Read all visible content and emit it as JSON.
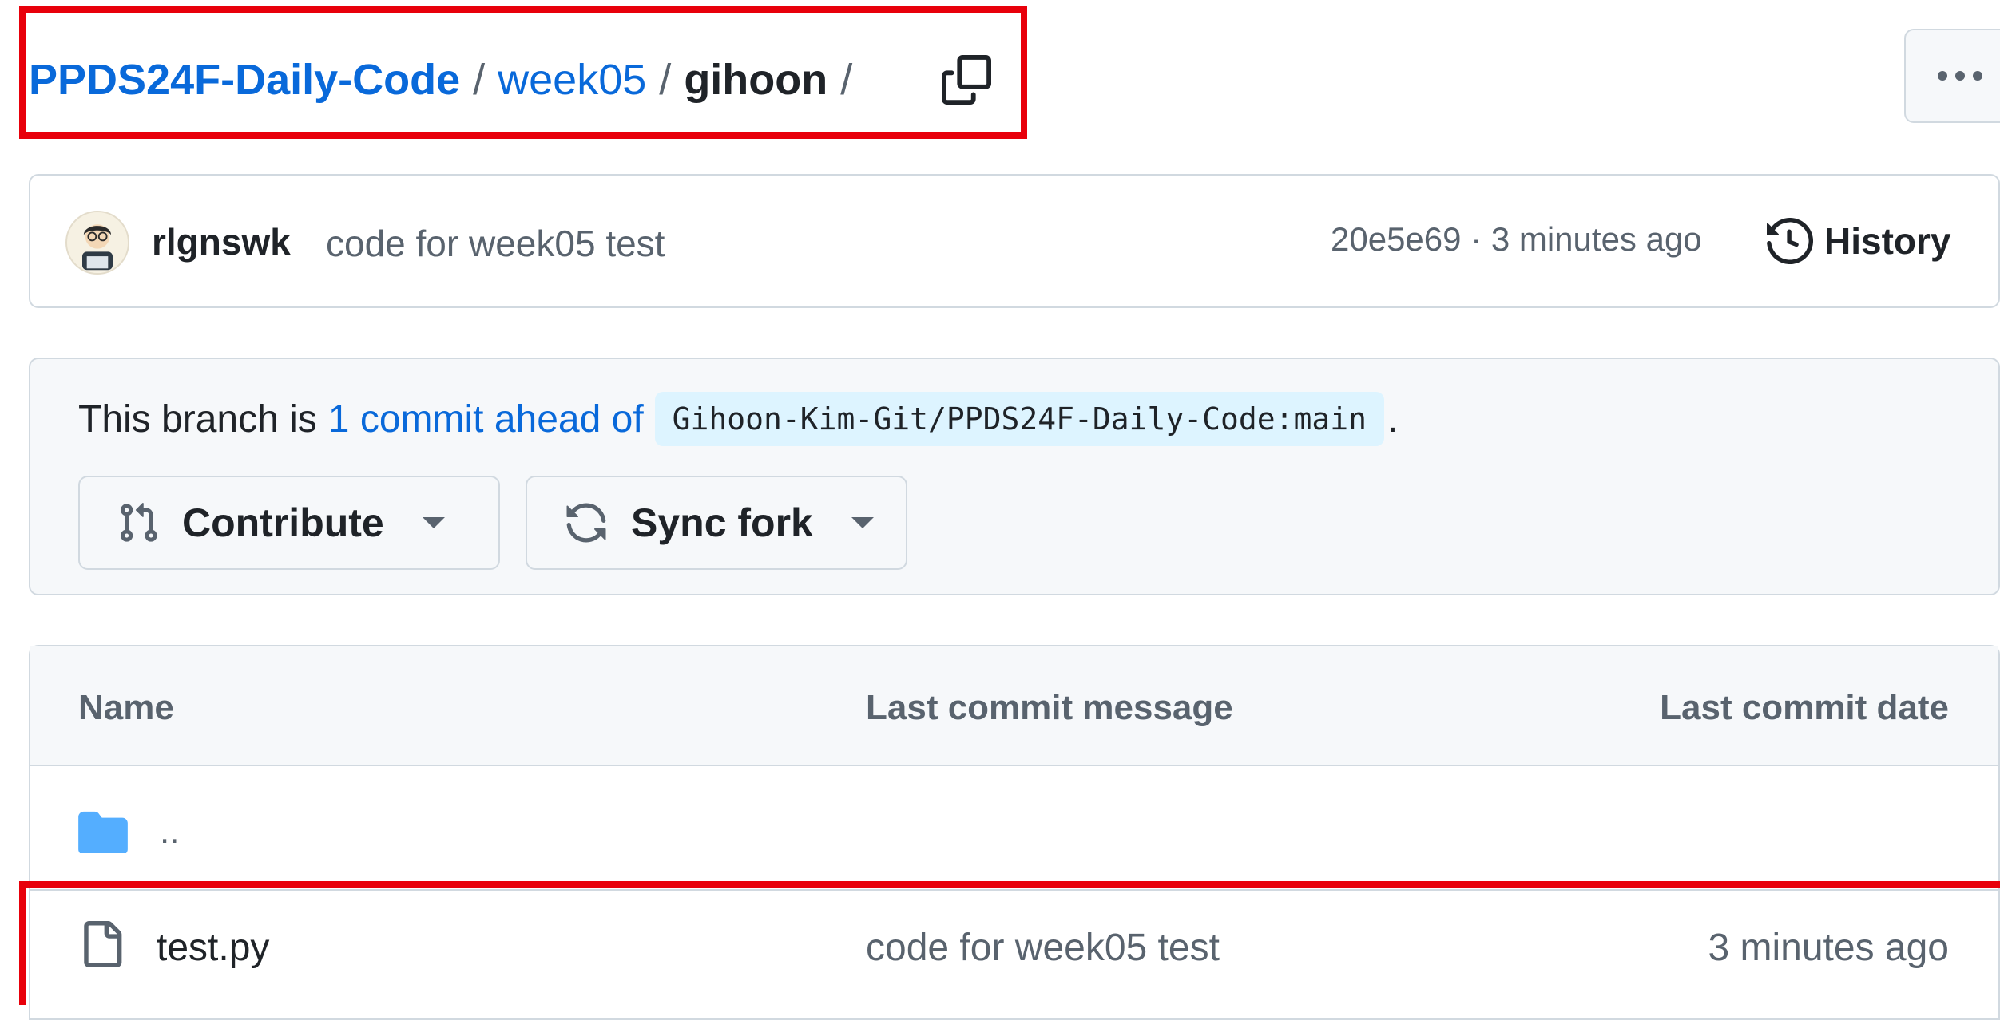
{
  "breadcrumb": {
    "repo": "PPDS24F-Daily-Code",
    "separator": "/",
    "folder": "week05",
    "current": "gihoon",
    "copy_icon": "copy-icon"
  },
  "more_icon": "kebab-horizontal-icon",
  "latest_commit": {
    "author": "rlgnswk",
    "message": "code for week05 test",
    "hash_and_time": "20e5e69 · 3 minutes ago",
    "history_label": "History",
    "history_icon": "history-icon"
  },
  "branch_status": {
    "prefix": "This branch is",
    "ahead_link": "1 commit ahead of",
    "ref": "Gihoon-Kim-Git/PPDS24F-Daily-Code:main",
    "suffix": ".",
    "contribute_label": "Contribute",
    "sync_label": "Sync fork"
  },
  "file_table": {
    "columns": [
      "Name",
      "Last commit message",
      "Last commit date"
    ],
    "parent_dir_label": "..",
    "files": [
      {
        "name": "test.py",
        "message": "code for week05 test",
        "date": "3 minutes ago",
        "icon": "file-icon"
      }
    ]
  },
  "colors": {
    "link": "#0969da",
    "highlight": "#e8000b",
    "folder_icon": "#54aeff",
    "muted": "#59636e"
  }
}
